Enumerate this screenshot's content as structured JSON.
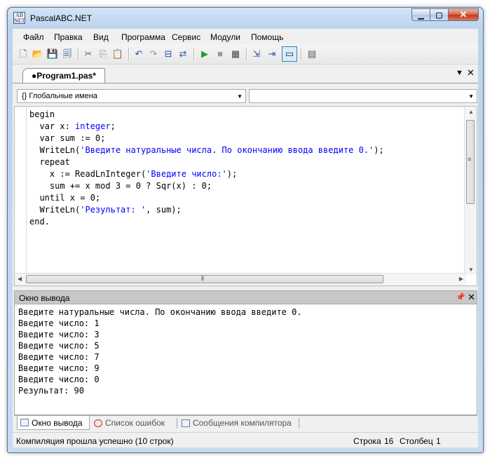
{
  "window": {
    "title": "PascalABC.NET",
    "icon_text": "AB NET"
  },
  "menu": [
    "Файл",
    "Правка",
    "Вид",
    "Программа",
    "Сервис",
    "Модули",
    "Помощь"
  ],
  "tab": {
    "label": "●Program1.pas*"
  },
  "combos": {
    "left_value": "{} Глобальные имена",
    "right_value": ""
  },
  "code_lines": [
    "begin",
    "  var x: integer;",
    "  var sum := 0;",
    "  WriteLn('Введите натуральные числа. По окончанию ввода введите 0.');",
    "  repeat",
    "    x := ReadLnInteger('Введите число:');",
    "    sum += x mod 3 = 0 ? Sqr(x) : 0;",
    "  until x = 0;",
    "  WriteLn('Результат: ', sum);",
    "end."
  ],
  "output_panel": {
    "title": "Окно вывода",
    "lines": [
      "Введите натуральные числа. По окончанию ввода введите 0.",
      "Введите число: 1",
      "Введите число: 3",
      "Введите число: 5",
      "Введите число: 7",
      "Введите число: 9",
      "Введите число: 0",
      "Результат: 90"
    ]
  },
  "bottom_tabs": [
    "Окно вывода",
    "Список ошибок",
    "Сообщения компилятора"
  ],
  "status": {
    "message": "Компиляция прошла успешно (10 строк)",
    "line_label": "Строка",
    "line_value": "16",
    "col_label": "Столбец",
    "col_value": "1"
  },
  "colors": {
    "keyword_type": "#0000ff",
    "string": "#0000ff",
    "title_bar": "#bcd3ee",
    "close_button": "#c23a17"
  }
}
